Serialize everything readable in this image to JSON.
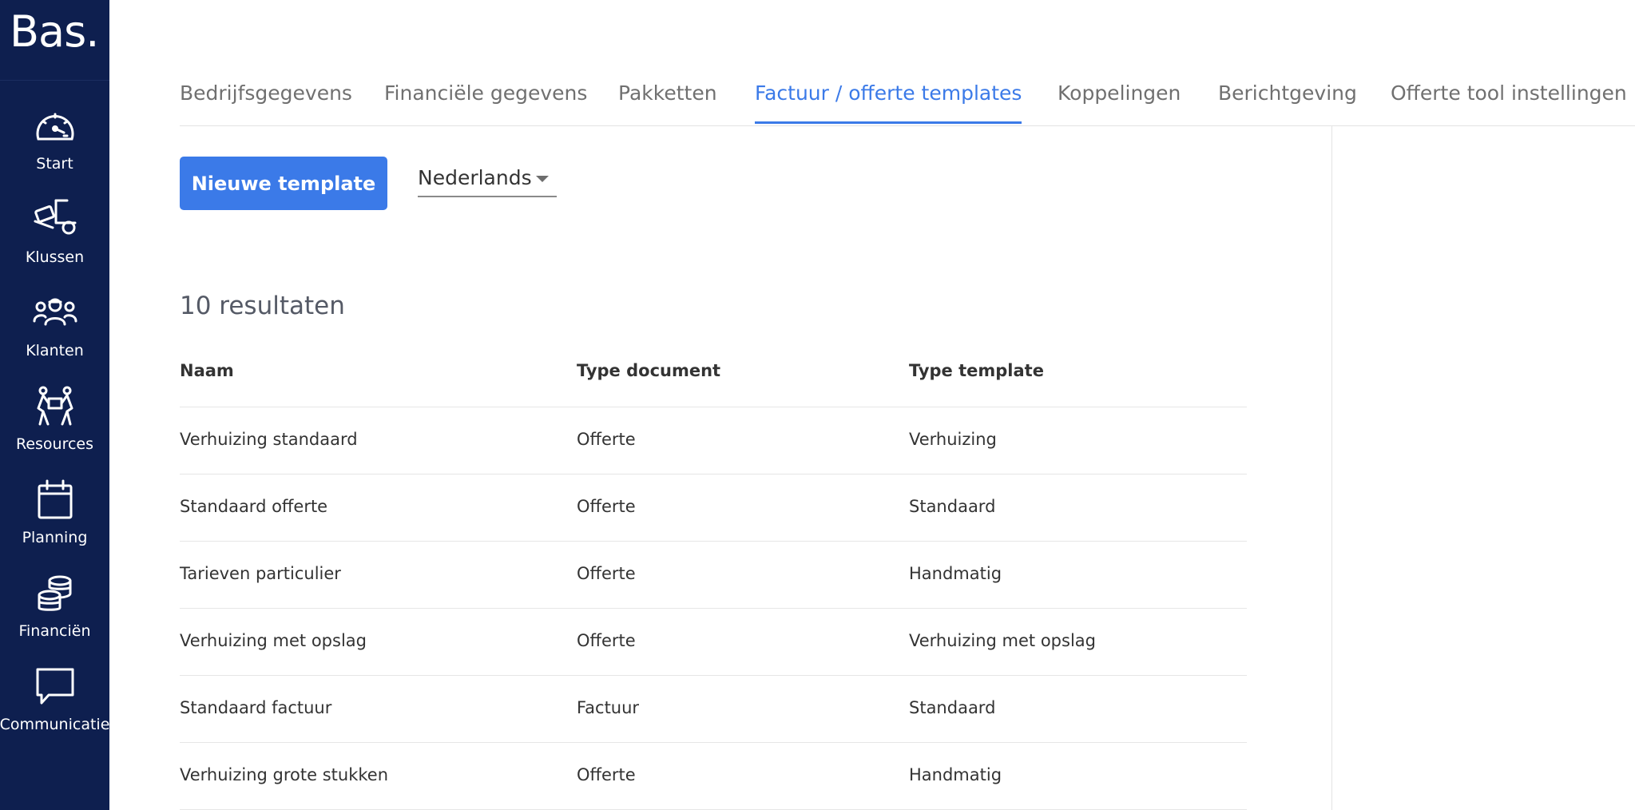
{
  "sidebar": {
    "logo": "Bas.",
    "items": [
      {
        "label": "Start",
        "icon": "speedometer-icon"
      },
      {
        "label": "Klussen",
        "icon": "moving-truck-icon"
      },
      {
        "label": "Klanten",
        "icon": "customers-icon"
      },
      {
        "label": "Resources",
        "icon": "movers-carrying-box-icon"
      },
      {
        "label": "Planning",
        "icon": "calendar-icon"
      },
      {
        "label": "Financiën",
        "icon": "coin-stack-icon"
      },
      {
        "label": "Communicatie",
        "icon": "chat-bubble-icon"
      }
    ]
  },
  "tabs": [
    {
      "label": "Bedrijfsgegevens",
      "active": false
    },
    {
      "label": "Financiële gegevens",
      "active": false
    },
    {
      "label": "Pakketten",
      "active": false
    },
    {
      "label": "Factuur / offerte templates",
      "active": true
    },
    {
      "label": "Koppelingen",
      "active": false
    },
    {
      "label": "Berichtgeving",
      "active": false
    },
    {
      "label": "Offerte tool instellingen",
      "active": false
    }
  ],
  "toolbar": {
    "new_button_label": "Nieuwe template",
    "language": "Nederlands"
  },
  "results": {
    "count_label": "10 resultaten"
  },
  "table": {
    "headers": [
      "Naam",
      "Type document",
      "Type template"
    ],
    "rows": [
      [
        "Verhuizing standaard",
        "Offerte",
        "Verhuizing"
      ],
      [
        "Standaard offerte",
        "Offerte",
        "Standaard"
      ],
      [
        "Tarieven particulier",
        "Offerte",
        "Handmatig"
      ],
      [
        "Verhuizing met opslag",
        "Offerte",
        "Verhuizing met opslag"
      ],
      [
        "Standaard factuur",
        "Factuur",
        "Standaard"
      ],
      [
        "Verhuizing grote stukken",
        "Offerte",
        "Handmatig"
      ]
    ]
  },
  "colors": {
    "sidebar_bg": "#0e1f4f",
    "accent": "#3b7ae8",
    "tab_inactive": "#707070"
  }
}
